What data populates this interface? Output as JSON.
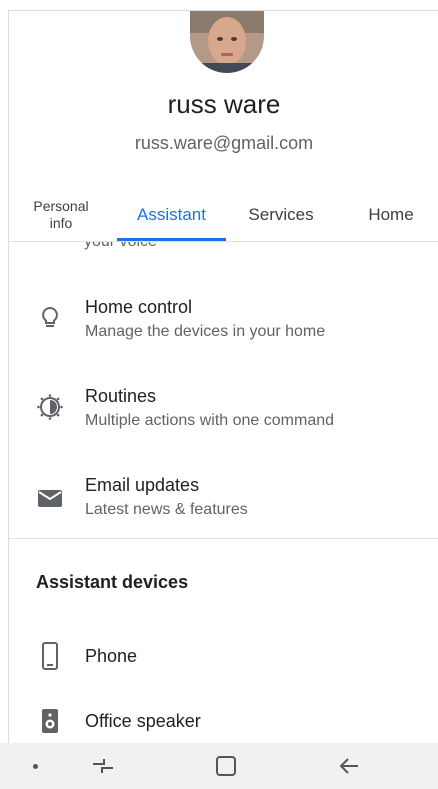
{
  "profile": {
    "name": "russ ware",
    "email": "russ.ware@gmail.com"
  },
  "tabs": [
    {
      "label": "Personal info",
      "active": false
    },
    {
      "label": "Assistant",
      "active": true
    },
    {
      "label": "Services",
      "active": false
    },
    {
      "label": "Home",
      "active": false
    }
  ],
  "list": {
    "partial_text": "your voice",
    "items": [
      {
        "title": "Home control",
        "subtitle": "Manage the devices in your home",
        "icon": "lightbulb-icon"
      },
      {
        "title": "Routines",
        "subtitle": "Multiple actions with one command",
        "icon": "routines-icon"
      },
      {
        "title": "Email updates",
        "subtitle": "Latest news & features",
        "icon": "mail-icon"
      }
    ]
  },
  "devices": {
    "heading": "Assistant devices",
    "items": [
      {
        "label": "Phone",
        "icon": "phone-icon"
      },
      {
        "label": "Office speaker",
        "icon": "speaker-icon"
      }
    ]
  },
  "colors": {
    "accent": "#1a73e8",
    "text_primary": "#202124",
    "text_secondary": "#5f6368",
    "navbar_bg": "#f1f1f1"
  }
}
